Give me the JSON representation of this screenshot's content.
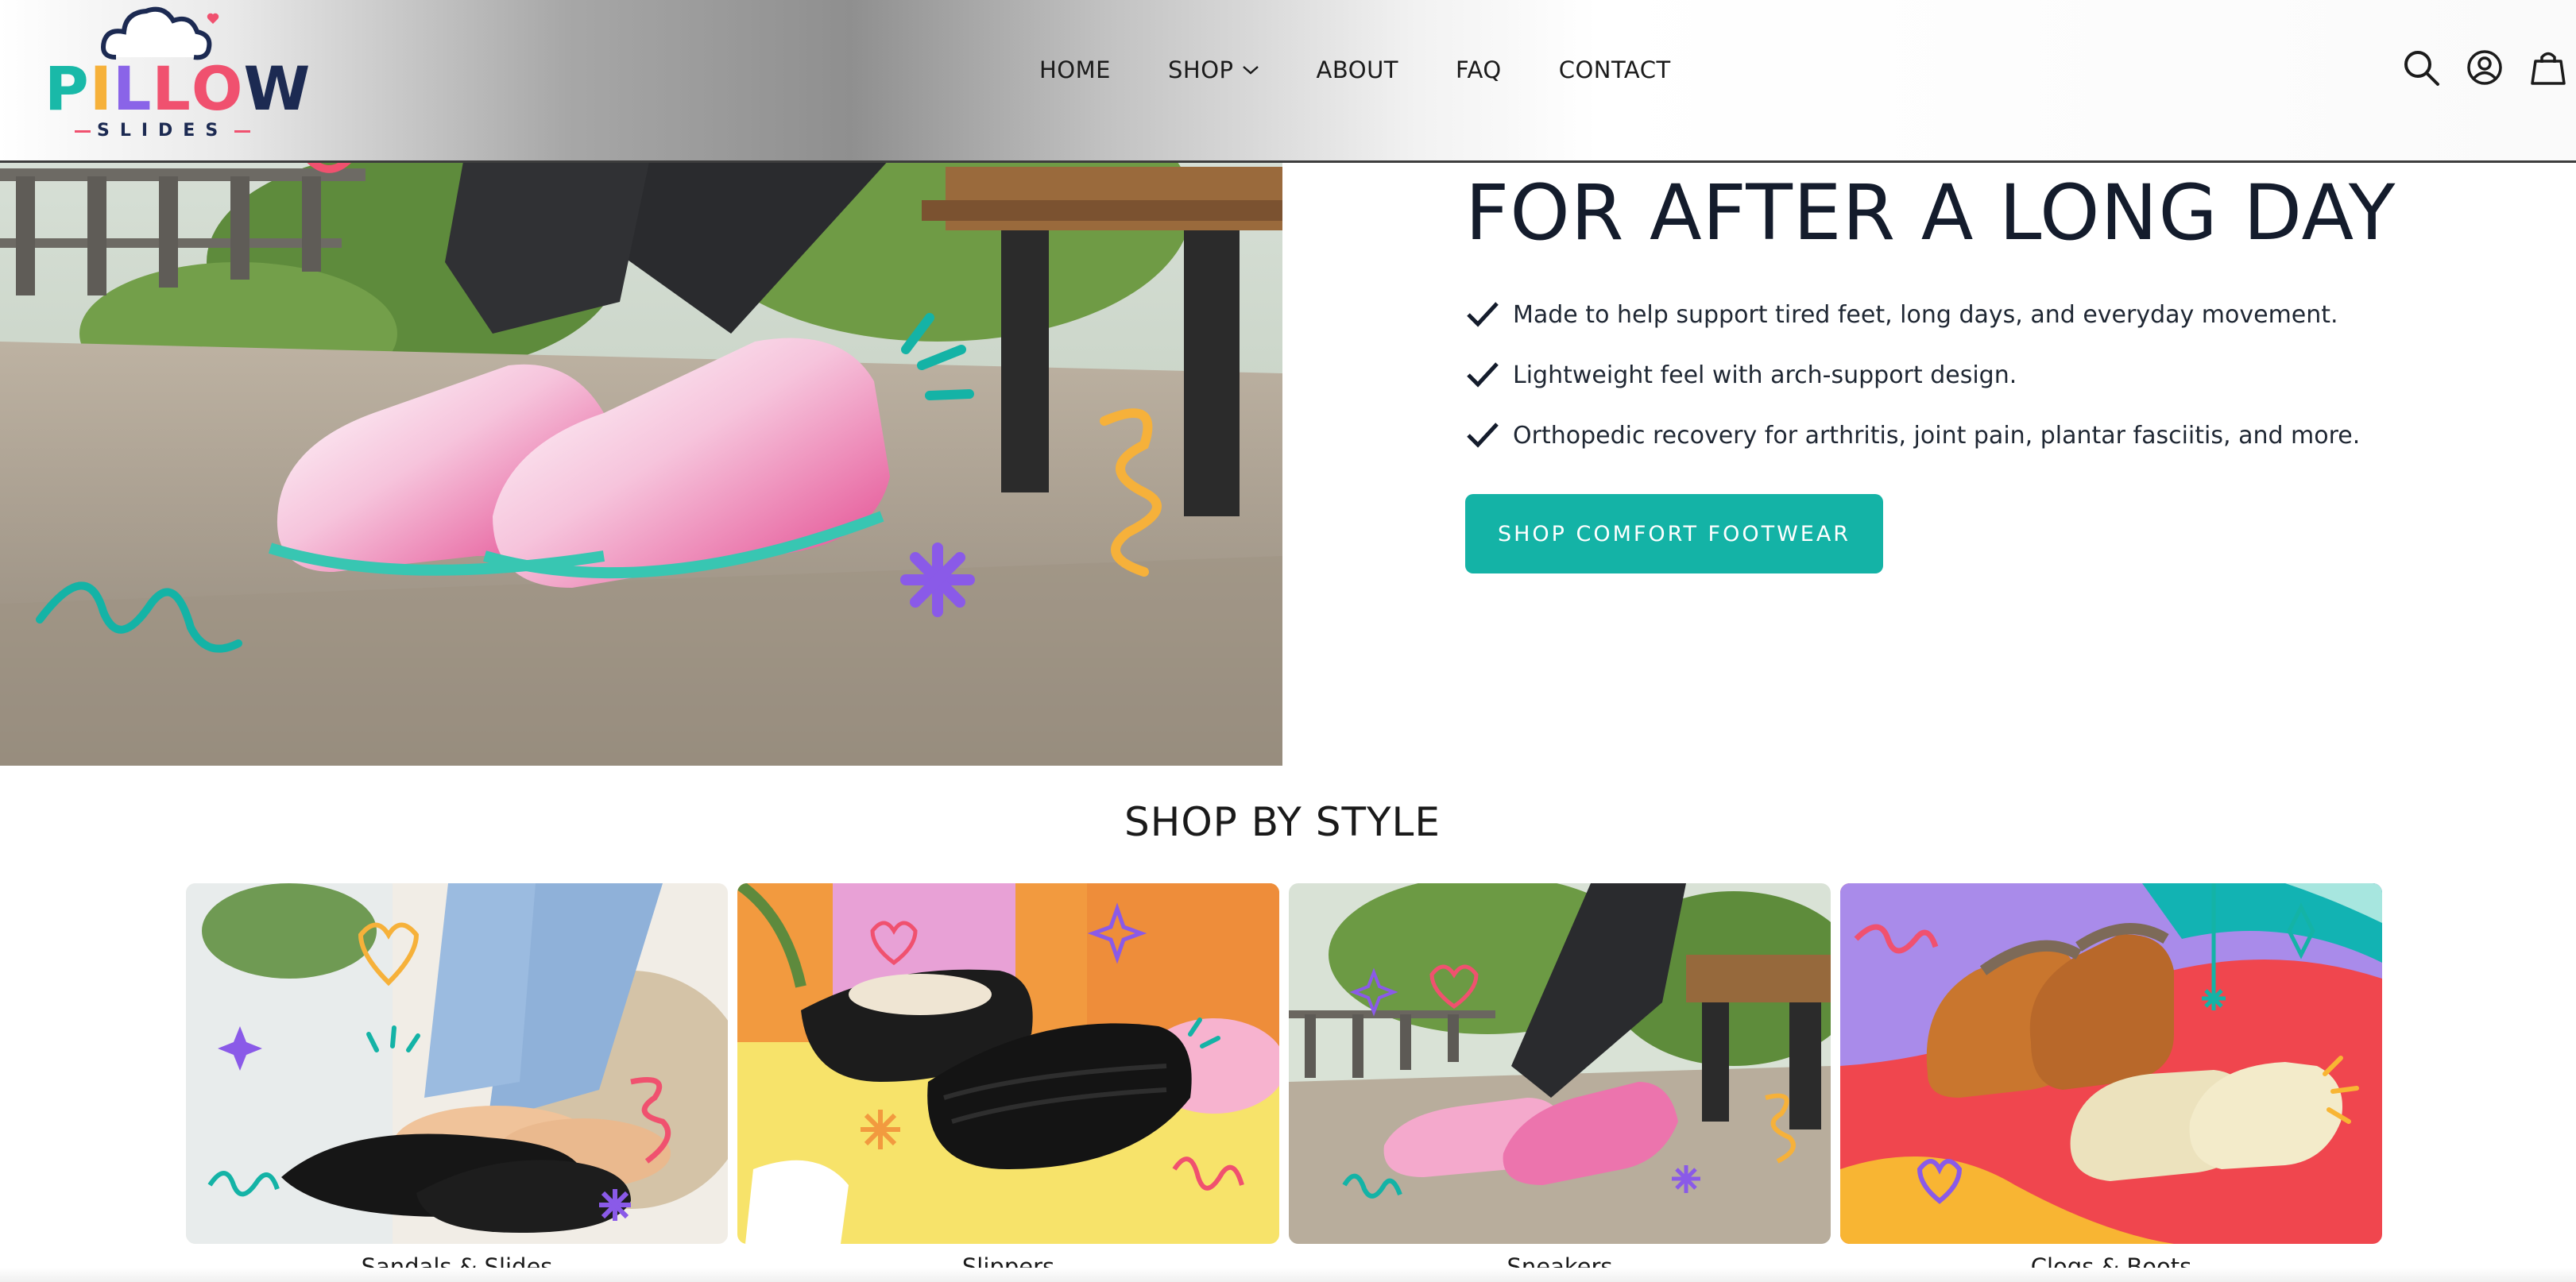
{
  "brand": {
    "name": "PILLOW",
    "letters": [
      "P",
      "I",
      "L",
      "L",
      "O",
      "W"
    ],
    "letter_colors": [
      "#19b9a8",
      "#f6b13a",
      "#8a64e8",
      "#f0516f",
      "#f0516f",
      "#1c2a52"
    ],
    "tagline": "SLIDES"
  },
  "nav": {
    "home": "HOME",
    "shop": "SHOP",
    "about": "ABOUT",
    "faq": "FAQ",
    "contact": "CONTACT"
  },
  "header_icons": [
    "search-icon",
    "account-icon",
    "cart-icon"
  ],
  "hero": {
    "title": "FOR AFTER A LONG DAY",
    "bullets": [
      "Made to help support tired feet, long days, and everyday movement.",
      "Lightweight feel with arch-support design.",
      "Orthopedic recovery for arthritis, joint pain, plantar fasciitis, and more."
    ],
    "cta_label": "SHOP COMFORT FOOTWEAR"
  },
  "shop_by_style": {
    "title": "SHOP BY STYLE",
    "categories": [
      {
        "label": "Sandals & Slides"
      },
      {
        "label": "Slippers"
      },
      {
        "label": "Sneakers"
      },
      {
        "label": "Clogs & Boots"
      }
    ]
  },
  "colors": {
    "accent": "#14b3a6",
    "heading": "#141c2c",
    "pink": "#e4418d",
    "purple": "#8a5ae8",
    "yellow": "#f6b13a",
    "coral": "#f0516f"
  }
}
